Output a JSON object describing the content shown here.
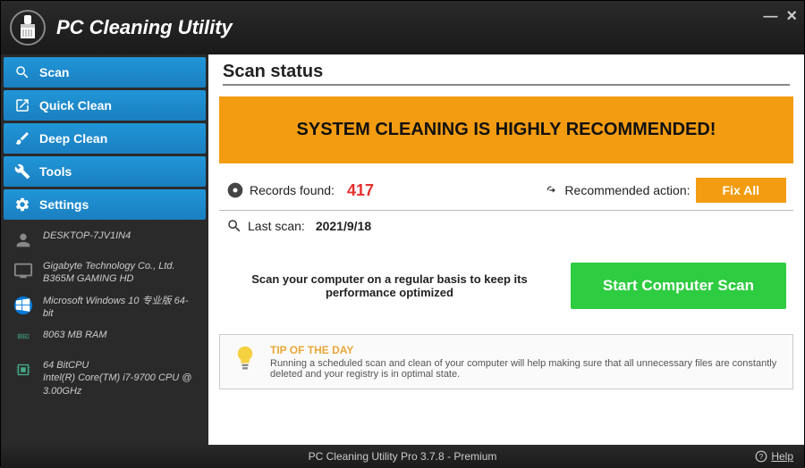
{
  "app": {
    "title": "PC Cleaning Utility"
  },
  "nav": {
    "scan": "Scan",
    "quick_clean": "Quick Clean",
    "deep_clean": "Deep Clean",
    "tools": "Tools",
    "settings": "Settings"
  },
  "sysinfo": {
    "hostname": "DESKTOP-7JV1IN4",
    "motherboard": "Gigabyte Technology Co., Ltd. B365M GAMING HD",
    "os": "Microsoft Windows 10 专业版 64-bit",
    "ram": "8063 MB RAM",
    "cpu": "64 BitCPU\nIntel(R) Core(TM) i7-9700 CPU @ 3.00GHz"
  },
  "page": {
    "title": "Scan status",
    "banner": "SYSTEM CLEANING IS HIGHLY RECOMMENDED!",
    "records_label": "Records found:",
    "records_value": "417",
    "action_label": "Recommended action:",
    "fix_all": "Fix All",
    "last_scan_label": "Last scan:",
    "last_scan_value": "2021/9/18",
    "scan_msg": "Scan your computer on a regular basis to keep its performance optimized",
    "scan_btn": "Start Computer Scan",
    "tip_title": "TIP OF THE DAY",
    "tip_body": "Running a scheduled scan and clean of your computer will help making sure that all unnecessary files are constantly deleted and your registry is in optimal state."
  },
  "footer": {
    "version": "PC Cleaning Utility Pro 3.7.8 - Premium",
    "help": "Help"
  }
}
